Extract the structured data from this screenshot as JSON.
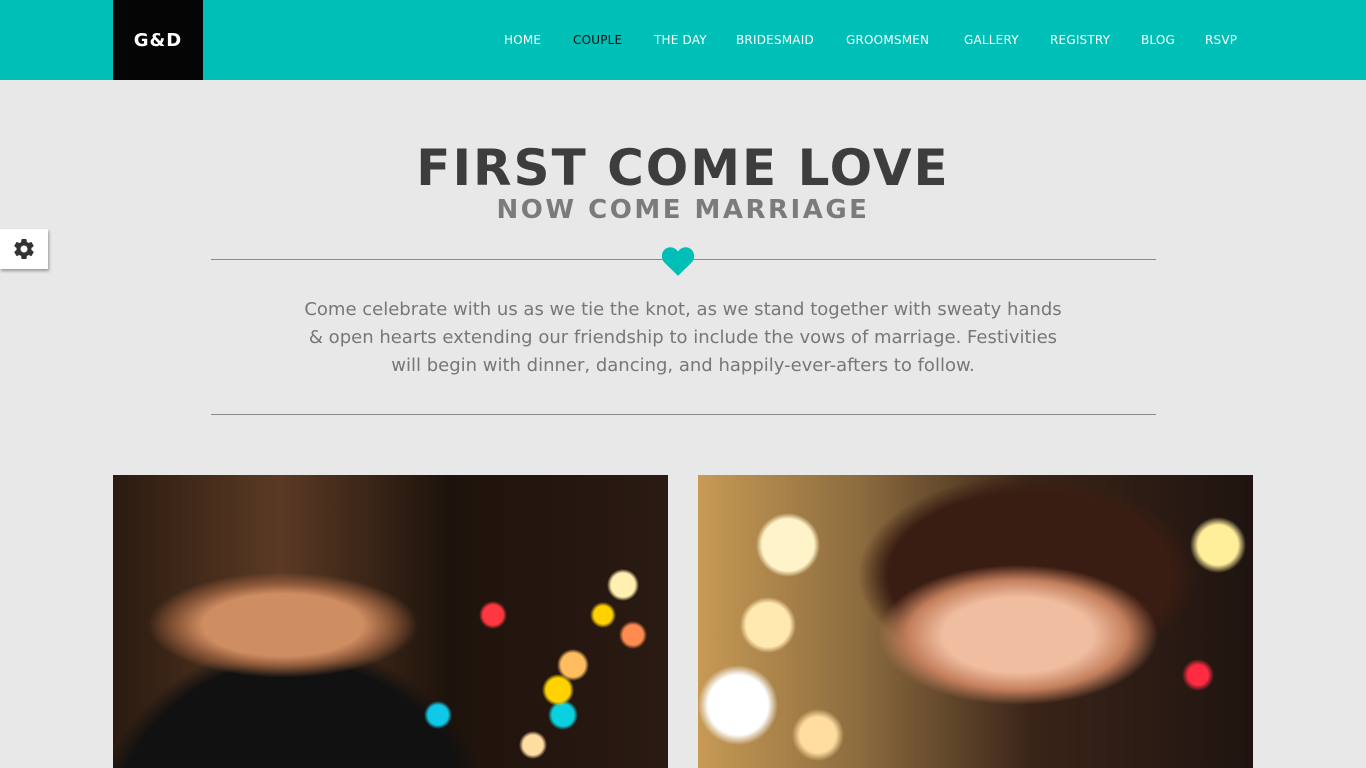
{
  "header": {
    "logo_text": "G&D",
    "accent_color": "#00bfb6",
    "nav": [
      {
        "label": "HOME",
        "active": false
      },
      {
        "label": "COUPLE",
        "active": true
      },
      {
        "label": "THE DAY",
        "active": false
      },
      {
        "label": "BRIDESMAID",
        "active": false
      },
      {
        "label": "GROOMSMEN",
        "active": false
      },
      {
        "label": "GALLERY",
        "active": false
      },
      {
        "label": "REGISTRY",
        "active": false
      },
      {
        "label": "BLOG",
        "active": false
      },
      {
        "label": "RSVP",
        "active": false
      }
    ]
  },
  "settings_tab": {
    "icon": "gear-icon"
  },
  "hero": {
    "title": "FIRST COME LOVE",
    "subtitle": "NOW COME MARRIAGE",
    "divider_icon": "heart-icon",
    "intro": "Come celebrate with us as we tie the knot, as we stand together with sweaty hands & open hearts extending our friendship to include the vows of marriage. Festivities will begin with dinner, dancing, and happily-ever-afters to follow."
  },
  "photos": [
    {
      "subject": "groom-photo"
    },
    {
      "subject": "bride-photo"
    }
  ]
}
